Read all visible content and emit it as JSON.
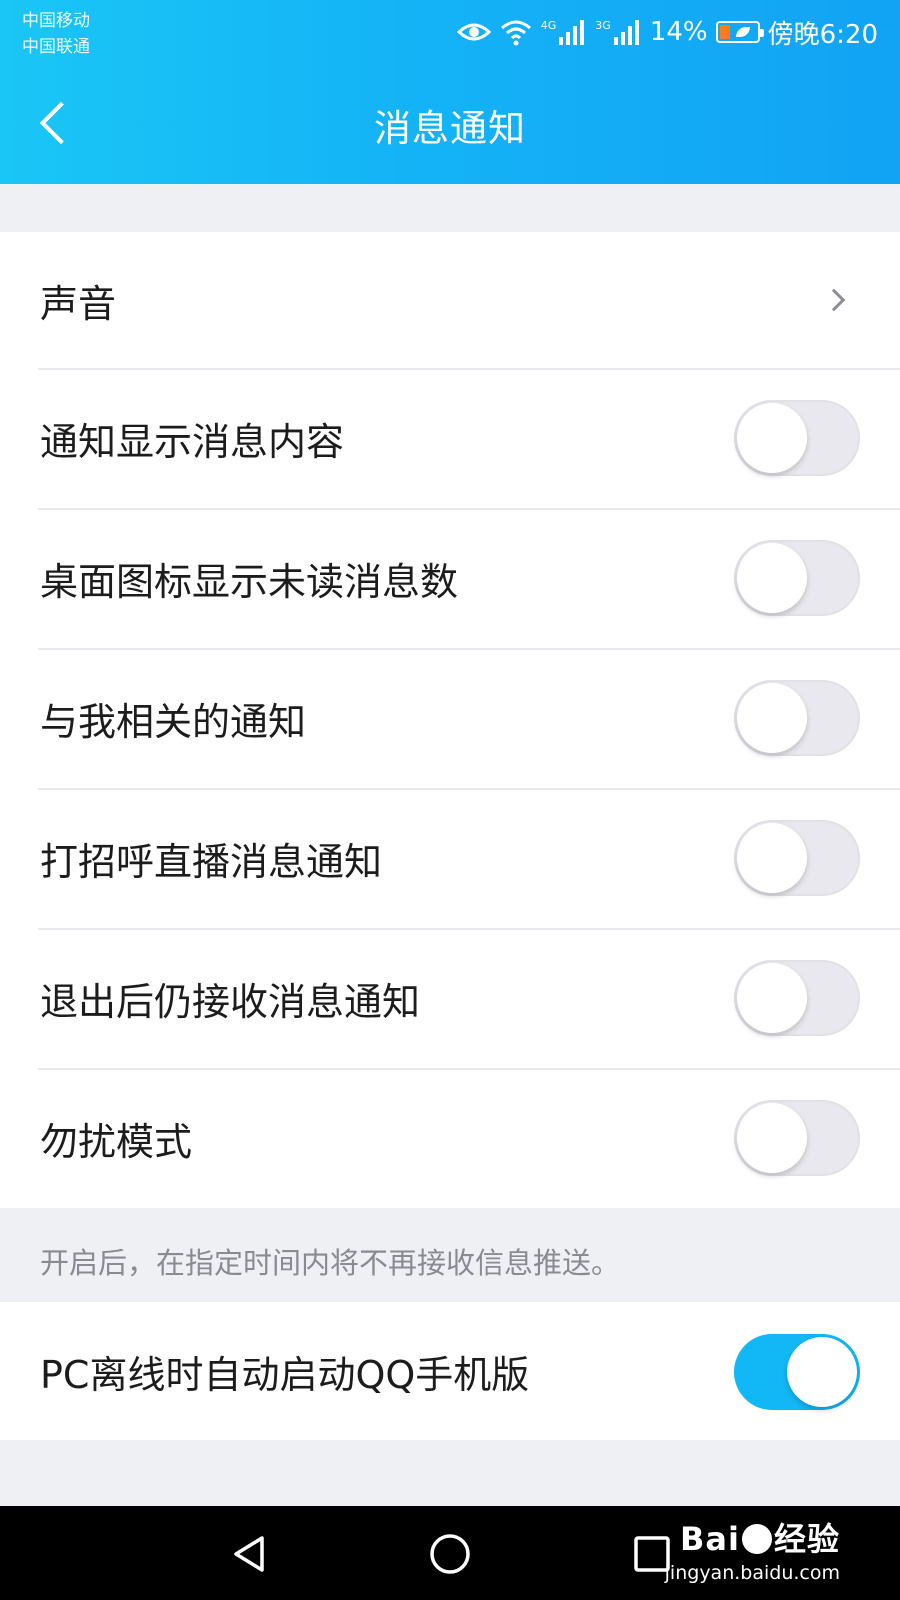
{
  "status_bar": {
    "carrier_1": "中国移动",
    "carrier_2": "中国联通",
    "signal_1_tag": "4G",
    "signal_2_tag": "3G",
    "battery_percent": "14%",
    "time": "傍晚6:20",
    "icons": [
      "eye-icon",
      "wifi-icon",
      "signal-icon",
      "battery-icon"
    ]
  },
  "header": {
    "title": "消息通知",
    "back_icon": "chevron-left-icon",
    "background_colors": [
      "#1ac6f6",
      "#12a3f4"
    ]
  },
  "settings": {
    "sound": {
      "label": "声音"
    },
    "items": [
      {
        "label": "通知显示消息内容",
        "on": false
      },
      {
        "label": "桌面图标显示未读消息数",
        "on": false
      },
      {
        "label": "与我相关的通知",
        "on": false
      },
      {
        "label": "打招呼直播消息通知",
        "on": false
      },
      {
        "label": "退出后仍接收消息通知",
        "on": false
      },
      {
        "label": "勿扰模式",
        "on": false
      }
    ],
    "dnd_hint": "开启后，在指定时间内将不再接收信息推送。",
    "pc_offline": {
      "label": "PC离线时自动启动QQ手机版",
      "on": true
    },
    "toggle_on_color": "#12b7f5"
  },
  "nav_bar": {
    "buttons": [
      "triangle-back-icon",
      "circle-home-icon",
      "square-recent-icon"
    ]
  },
  "watermark": {
    "logo_text": "Bai",
    "logo_suffix": "经验",
    "url": "jingyan.baidu.com"
  }
}
